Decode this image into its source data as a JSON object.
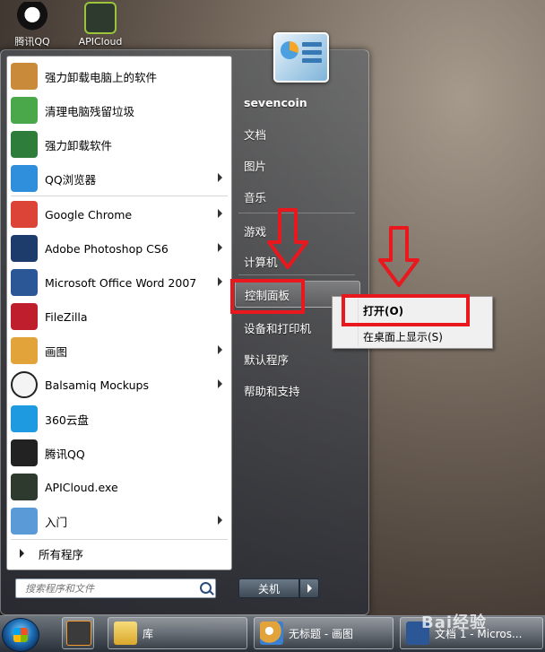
{
  "desktop": {
    "icons": [
      {
        "label": "腾讯QQ",
        "icon": "qq-penguin-icon"
      },
      {
        "label": "APICloud",
        "icon": "apicloud-icon"
      }
    ]
  },
  "start_menu": {
    "pinned": [
      {
        "label": "强力卸载电脑上的软件",
        "icon": "uninstall-box-icon",
        "has_arrow": false,
        "color": "#c98a3a"
      },
      {
        "label": "清理电脑残留垃圾",
        "icon": "recycle-bin-icon",
        "has_arrow": false,
        "color": "#4aa84a"
      },
      {
        "label": "强力卸载软件",
        "icon": "shield-app-icon",
        "has_arrow": false,
        "color": "#2f7d3a"
      },
      {
        "label": "QQ浏览器",
        "icon": "qq-browser-icon",
        "has_arrow": true,
        "color": "#2f8fdc"
      }
    ],
    "recent": [
      {
        "label": "Google Chrome",
        "icon": "chrome-icon",
        "has_arrow": true,
        "color": "#db4437"
      },
      {
        "label": "Adobe Photoshop CS6",
        "icon": "photoshop-icon",
        "has_arrow": true,
        "color": "#1d3c6b"
      },
      {
        "label": "Microsoft Office Word 2007",
        "icon": "word-icon",
        "has_arrow": true,
        "color": "#2b5797"
      },
      {
        "label": "FileZilla",
        "icon": "filezilla-icon",
        "has_arrow": false,
        "color": "#bf1e2d"
      },
      {
        "label": "画图",
        "icon": "paint-icon",
        "has_arrow": true,
        "color": "#e2a33a"
      },
      {
        "label": "Balsamiq Mockups",
        "icon": "balsamiq-icon",
        "has_arrow": true,
        "color": "#f4f4f4"
      },
      {
        "label": "360云盘",
        "icon": "cloud-drive-icon",
        "has_arrow": false,
        "color": "#1e9be0"
      },
      {
        "label": "腾讯QQ",
        "icon": "qq-penguin-icon",
        "has_arrow": false,
        "color": "#222222"
      },
      {
        "label": "APICloud.exe",
        "icon": "apicloud-icon",
        "has_arrow": false,
        "color": "#2d3a2d"
      },
      {
        "label": "入门",
        "icon": "getting-started-icon",
        "has_arrow": true,
        "color": "#5a9ad6"
      }
    ],
    "all_programs": "所有程序",
    "search_placeholder": "搜索程序和文件",
    "right_items": [
      "sevencoin",
      "文档",
      "图片",
      "音乐",
      "游戏",
      "计算机",
      "控制面板",
      "设备和打印机",
      "默认程序",
      "帮助和支持"
    ],
    "shutdown_label": "关机"
  },
  "context_menu": {
    "items": [
      "打开(O)",
      "在桌面上显示(S)"
    ]
  },
  "taskbar": {
    "buttons": [
      {
        "label": "",
        "icon": "sublime-text-icon"
      },
      {
        "label": "库",
        "icon": "library-folder-icon"
      },
      {
        "label": "无标题 - 画图",
        "icon": "paint-icon"
      },
      {
        "label": "文档 1 - Micros...",
        "icon": "word-icon"
      }
    ]
  },
  "watermark": "Bai经验",
  "colors": {
    "accent_red": "#e8181e"
  }
}
